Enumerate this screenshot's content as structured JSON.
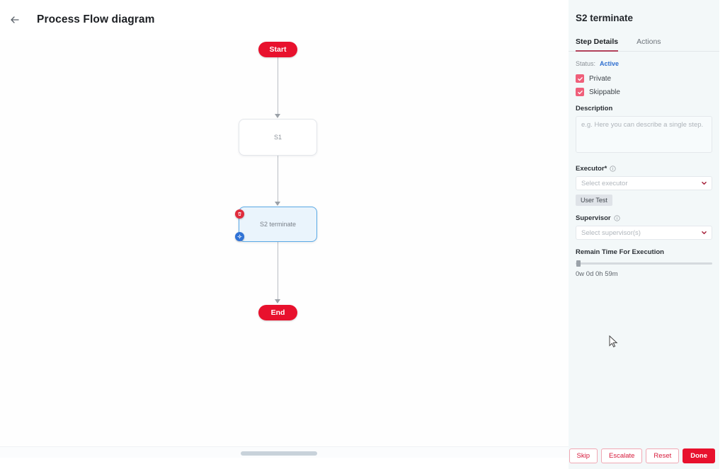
{
  "header": {
    "back_icon": "arrow-left-icon",
    "title": "Process Flow diagram"
  },
  "diagram": {
    "nodes": [
      {
        "id": "start",
        "label": "Start",
        "type": "terminator"
      },
      {
        "id": "s1",
        "label": "S1",
        "type": "step"
      },
      {
        "id": "s2",
        "label": "S2 terminate",
        "type": "step",
        "selected": true
      },
      {
        "id": "end",
        "label": "End",
        "type": "terminator"
      }
    ],
    "node_badges": [
      {
        "name": "delete-step-icon",
        "color": "#e02b3c"
      },
      {
        "name": "settings-step-icon",
        "color": "#2f72d6"
      }
    ],
    "accent_color": "#e8112d",
    "selected_fill": "#eaf4fc",
    "selected_border": "#5aa9e6"
  },
  "panel": {
    "title": "S2 terminate",
    "tabs": [
      {
        "label": "Step Details",
        "active": true
      },
      {
        "label": "Actions",
        "active": false
      }
    ],
    "tab_underline_color": "#b2415a",
    "status": {
      "label": "Status:",
      "value": "Active",
      "value_color": "#2f6fd0"
    },
    "checkboxes": [
      {
        "label": "Private",
        "checked": true
      },
      {
        "label": "Skippable",
        "checked": true
      }
    ],
    "checkbox_color": "#ef5f7a",
    "description": {
      "label": "Description",
      "value": "",
      "placeholder": "e.g. Here you can describe a single step."
    },
    "executor": {
      "label": "Executor*",
      "info_icon": "info-circle-icon",
      "value": "",
      "placeholder": "Select executor",
      "chips": [
        "User Test"
      ]
    },
    "supervisor": {
      "label": "Supervisor",
      "info_icon": "info-circle-icon",
      "value": "",
      "placeholder": "Select supervisor(s)"
    },
    "remain_time": {
      "label": "Remain Time For Execution",
      "value": "0w 0d 0h 59m",
      "slider_percent": 1
    },
    "footer_buttons": [
      {
        "label": "Skip",
        "style": "outline"
      },
      {
        "label": "Escalate",
        "style": "outline"
      },
      {
        "label": "Reset",
        "style": "outline"
      },
      {
        "label": "Done",
        "style": "filled"
      }
    ]
  }
}
